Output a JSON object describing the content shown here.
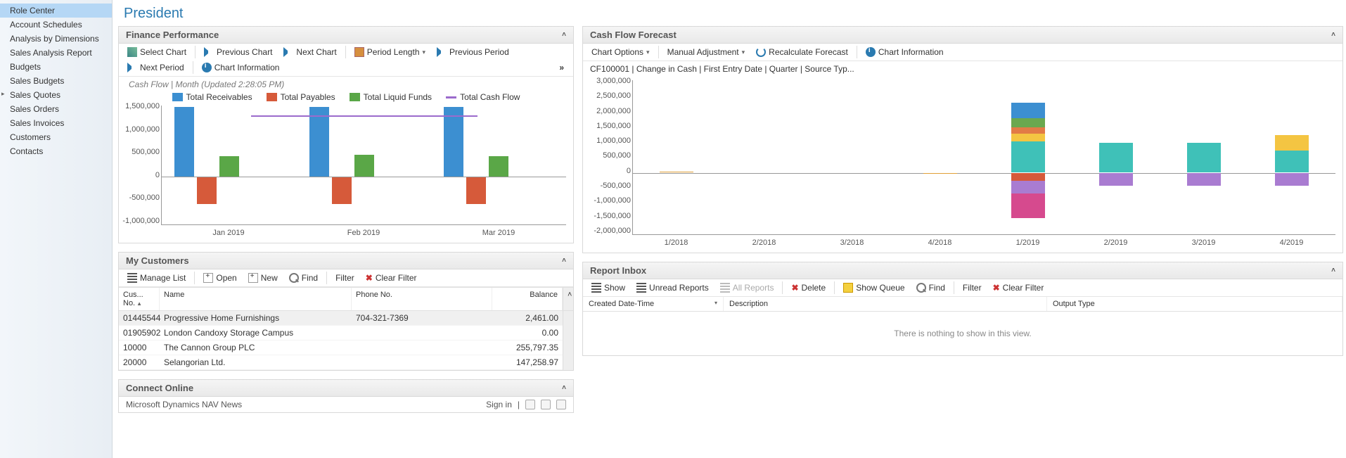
{
  "page_title": "President",
  "sidebar": {
    "items": [
      {
        "label": "Role Center",
        "selected": true
      },
      {
        "label": "Account Schedules"
      },
      {
        "label": "Analysis by Dimensions"
      },
      {
        "label": "Sales Analysis Report"
      },
      {
        "label": "Budgets"
      },
      {
        "label": "Sales Budgets"
      },
      {
        "label": "Sales Quotes",
        "expandable": true
      },
      {
        "label": "Sales Orders"
      },
      {
        "label": "Sales Invoices"
      },
      {
        "label": "Customers"
      },
      {
        "label": "Contacts"
      }
    ]
  },
  "finance_panel": {
    "title": "Finance Performance",
    "toolbar": {
      "select_chart": "Select Chart",
      "previous_chart": "Previous Chart",
      "next_chart": "Next Chart",
      "period_length": "Period Length",
      "previous_period": "Previous Period",
      "next_period": "Next Period",
      "chart_information": "Chart Information",
      "more": "»"
    },
    "subtitle": "Cash Flow | Month (Updated  2:28:05 PM)",
    "legend": {
      "receivables": "Total Receivables",
      "payables": "Total Payables",
      "liquid": "Total Liquid Funds",
      "cashflow": "Total Cash Flow"
    },
    "colors": {
      "receivables": "#3c8fd1",
      "payables": "#d65a3a",
      "liquid": "#5aa747",
      "cashflow": "#9b6bcc"
    }
  },
  "customers_panel": {
    "title": "My Customers",
    "toolbar": {
      "manage_list": "Manage List",
      "open": "Open",
      "new": "New",
      "find": "Find",
      "filter": "Filter",
      "clear_filter": "Clear Filter"
    },
    "columns": {
      "no": "Cus... No.",
      "name": "Name",
      "phone": "Phone No.",
      "balance": "Balance"
    },
    "rows": [
      {
        "no": "01445544",
        "name": "Progressive Home Furnishings",
        "phone": "704-321-7369",
        "balance": "2,461.00"
      },
      {
        "no": "01905902",
        "name": "London Candoxy Storage Campus",
        "phone": "",
        "balance": "0.00"
      },
      {
        "no": "10000",
        "name": "The Cannon Group PLC",
        "phone": "",
        "balance": "255,797.35"
      },
      {
        "no": "20000",
        "name": "Selangorian Ltd.",
        "phone": "",
        "balance": "147,258.97"
      }
    ]
  },
  "connect_panel": {
    "title": "Connect Online",
    "news": "Microsoft Dynamics NAV News",
    "signin": "Sign in"
  },
  "cash_panel": {
    "title": "Cash Flow Forecast",
    "toolbar": {
      "chart_options": "Chart Options",
      "manual_adjustment": "Manual Adjustment",
      "recalculate": "Recalculate Forecast",
      "chart_information": "Chart Information"
    },
    "subtitle": "CF100001 | Change in Cash | First Entry Date | Quarter | Source Typ..."
  },
  "report_panel": {
    "title": "Report Inbox",
    "toolbar": {
      "show": "Show",
      "unread": "Unread Reports",
      "all": "All Reports",
      "delete": "Delete",
      "show_queue": "Show Queue",
      "find": "Find",
      "filter": "Filter",
      "clear_filter": "Clear Filter"
    },
    "columns": {
      "created": "Created Date-Time",
      "description": "Description",
      "output_type": "Output Type"
    },
    "empty_msg": "There is nothing to show in this view."
  },
  "chart_data": [
    {
      "id": "finance_performance",
      "type": "bar",
      "categories": [
        "Jan 2019",
        "Feb 2019",
        "Mar 2019"
      ],
      "series": [
        {
          "name": "Total Receivables",
          "color": "#3c8fd1",
          "values": [
            1450000,
            1450000,
            1450000
          ]
        },
        {
          "name": "Total Payables",
          "color": "#d65a3a",
          "values": [
            -560000,
            -560000,
            -560000
          ]
        },
        {
          "name": "Total Liquid Funds",
          "color": "#5aa747",
          "values": [
            430000,
            450000,
            430000
          ]
        },
        {
          "name": "Total Cash Flow",
          "color": "#9b6bcc",
          "type": "line",
          "values": [
            1300000,
            1300000,
            1300000
          ]
        }
      ],
      "ylim": [
        -1000000,
        1500000
      ],
      "yticks": [
        "1,500,000",
        "1,000,000",
        "500,000",
        "0",
        "-500,000",
        "-1,000,000"
      ]
    },
    {
      "id": "cash_flow_forecast",
      "type": "stacked-bar",
      "categories": [
        "1/2018",
        "2/2018",
        "3/2018",
        "4/2018",
        "1/2019",
        "2/2019",
        "3/2019",
        "4/2019"
      ],
      "series": [
        {
          "name": "seg1",
          "color": "#3fc1b8",
          "values": [
            0,
            0,
            0,
            0,
            1000000,
            950000,
            950000,
            700000
          ]
        },
        {
          "name": "seg2",
          "color": "#f4c542",
          "values": [
            0,
            0,
            0,
            0,
            250000,
            0,
            0,
            500000
          ]
        },
        {
          "name": "seg3",
          "color": "#e27b46",
          "values": [
            0,
            0,
            0,
            0,
            200000,
            0,
            0,
            0
          ]
        },
        {
          "name": "seg4",
          "color": "#6aa84f",
          "values": [
            0,
            0,
            0,
            0,
            300000,
            0,
            0,
            0
          ]
        },
        {
          "name": "seg5",
          "color": "#3c8fd1",
          "values": [
            0,
            0,
            0,
            0,
            500000,
            0,
            0,
            0
          ]
        },
        {
          "name": "seg_neg1",
          "color": "#d65a3a",
          "values": [
            0,
            0,
            0,
            0,
            -250000,
            0,
            0,
            0
          ]
        },
        {
          "name": "seg_neg2",
          "color": "#a97cd1",
          "values": [
            0,
            0,
            0,
            0,
            -400000,
            -400000,
            -400000,
            -400000
          ]
        },
        {
          "name": "seg_neg3",
          "color": "#d64a8e",
          "values": [
            0,
            0,
            0,
            0,
            -800000,
            0,
            0,
            0
          ]
        },
        {
          "name": "tiny",
          "color": "#e0a038",
          "values": [
            30000,
            0,
            0,
            -30000,
            0,
            0,
            0,
            0
          ]
        }
      ],
      "ylim": [
        -2000000,
        3000000
      ],
      "yticks": [
        "3,000,000",
        "2,500,000",
        "2,000,000",
        "1,500,000",
        "1,000,000",
        "500,000",
        "0",
        "-500,000",
        "-1,000,000",
        "-1,500,000",
        "-2,000,000"
      ]
    }
  ]
}
